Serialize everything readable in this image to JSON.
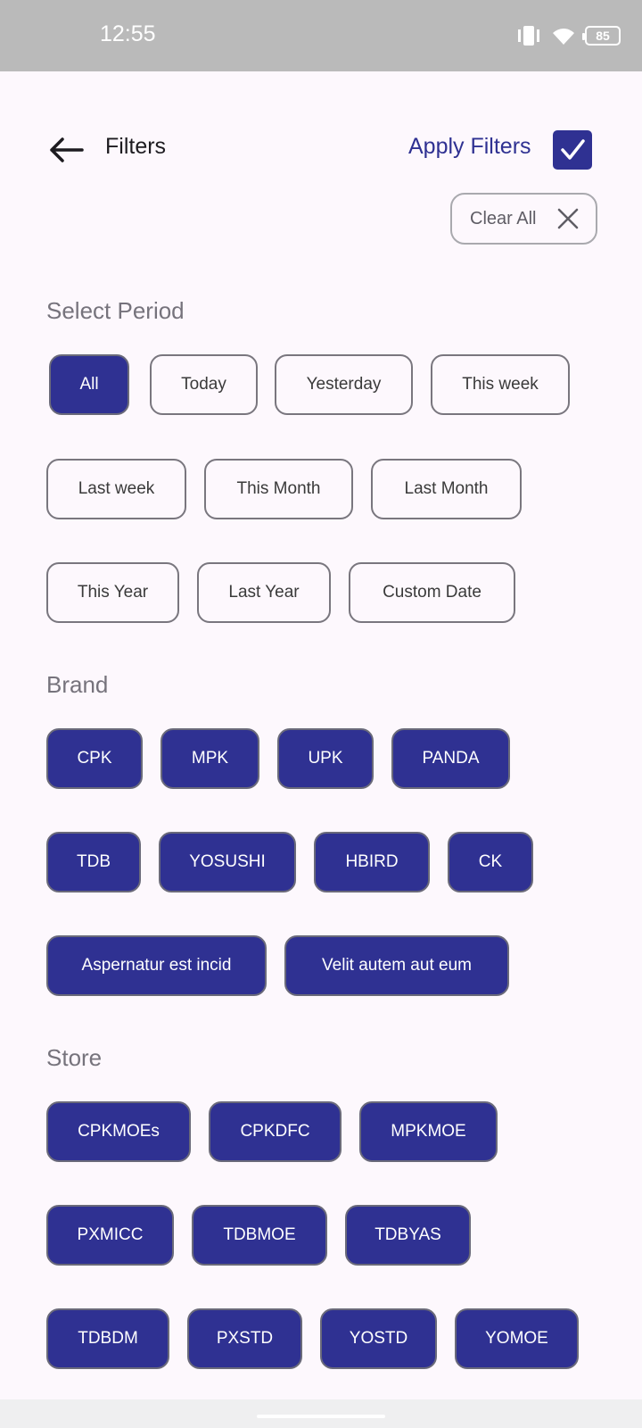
{
  "status_bar": {
    "time": "12:55",
    "battery": "85"
  },
  "header": {
    "title": "Filters",
    "apply_label": "Apply Filters",
    "clear_label": "Clear All"
  },
  "period": {
    "title": "Select Period",
    "options": [
      "All",
      "Today",
      "Yesterday",
      "This week",
      "Last week",
      "This Month",
      "Last Month",
      "This Year",
      "Last Year",
      "Custom Date"
    ],
    "selected": "All"
  },
  "brand": {
    "title": "Brand",
    "options": [
      "CPK",
      "MPK",
      "UPK",
      "PANDA",
      "TDB",
      "YOSUSHI",
      "HBIRD",
      "CK",
      "Aspernatur est incid",
      "Velit autem aut eum"
    ]
  },
  "store": {
    "title": "Store",
    "options": [
      "CPKMOEs",
      "CPKDFC",
      "MPKMOE",
      "PXMICC",
      "TDBMOE",
      "TDBYAS",
      "TDBDM",
      "PXSTD",
      "YOSTD",
      "YOMOE"
    ]
  },
  "colors": {
    "accent": "#2f3192",
    "outline": "#79767e",
    "background": "#fdf8fd"
  }
}
